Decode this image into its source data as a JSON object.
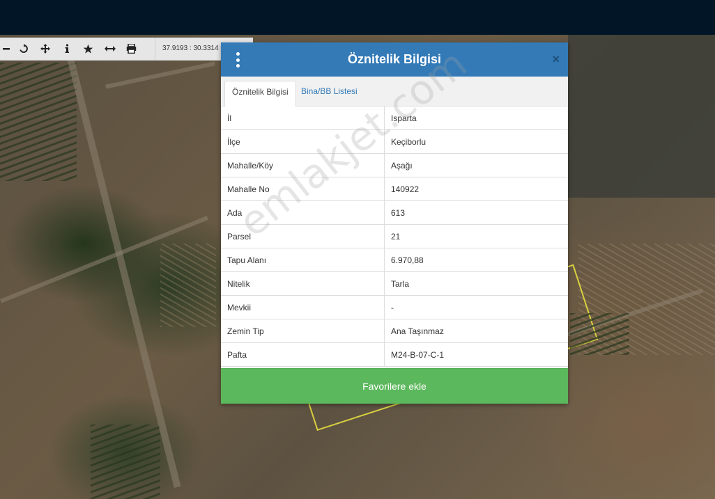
{
  "toolbar": {
    "coordinates": "37.9193 : 30.3314",
    "tools": [
      "zoom-out-icon",
      "refresh-icon",
      "pan-icon",
      "info-icon",
      "favorite-icon",
      "measure-icon",
      "print-icon"
    ]
  },
  "dialog": {
    "title": "Öznitelik Bilgisi",
    "close": "×",
    "tabs": [
      {
        "label": "Öznitelik Bilgisi",
        "active": true
      },
      {
        "label": "Bina/BB Listesi",
        "active": false
      }
    ],
    "rows": [
      {
        "key": "İl",
        "value": "Isparta"
      },
      {
        "key": "İlçe",
        "value": "Keçiborlu"
      },
      {
        "key": "Mahalle/Köy",
        "value": "Aşağı"
      },
      {
        "key": "Mahalle No",
        "value": "140922"
      },
      {
        "key": "Ada",
        "value": "613"
      },
      {
        "key": "Parsel",
        "value": "21"
      },
      {
        "key": "Tapu Alanı",
        "value": "6.970,88"
      },
      {
        "key": "Nitelik",
        "value": "Tarla"
      },
      {
        "key": "Mevkii",
        "value": "-"
      },
      {
        "key": "Zemin Tip",
        "value": "Ana Taşınmaz"
      },
      {
        "key": "Pafta",
        "value": "M24-B-07-C-1"
      }
    ],
    "favorite_button": "Favorilere ekle"
  },
  "watermark": "emlakjet.com",
  "colors": {
    "header": "#337ab7",
    "favorite": "#5cb85c",
    "topbar": "#011526",
    "parcel": "#d8d040"
  }
}
